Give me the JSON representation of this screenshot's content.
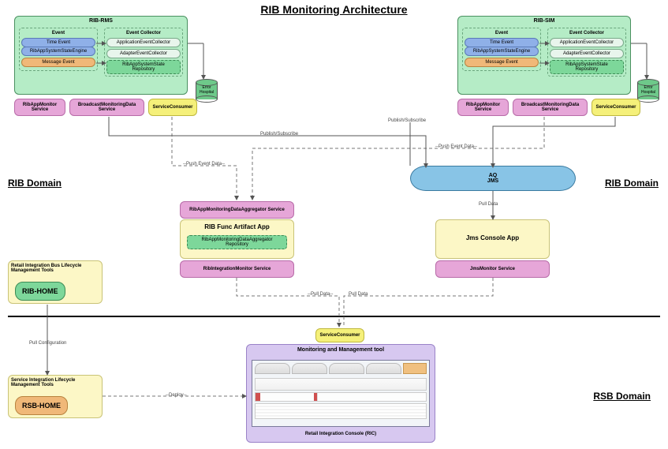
{
  "title": "RIB Monitoring Architecture",
  "domains": {
    "rib_left": "RIB Domain",
    "rib_right": "RIB Domain",
    "rsb": "RSB Domain"
  },
  "rib_rms": {
    "title": "RIB-RMS",
    "event_group": "Event",
    "time_event": "Time Event",
    "state_engine": "RibAppSystemStateEngine",
    "message_event": "Message Event",
    "collector_group": "Event Collector",
    "app_collector": "ApplicationEventCollector",
    "adapter_collector": "AdapterEventCollector",
    "repo": "RibAppSystemState Repository"
  },
  "rib_sim": {
    "title": "RIB-SIM",
    "event_group": "Event",
    "time_event": "Time Event",
    "state_engine": "RibAppSystemStateEngine",
    "message_event": "Message Event",
    "collector_group": "Event Collector",
    "app_collector": "ApplicationEventCollector",
    "adapter_collector": "AdapterEventCollector",
    "repo": "RibAppSystemState Repository"
  },
  "services": {
    "rib_app_monitor": "RibAppMonitor Service",
    "broadcast": "BroadcastMonitoringData Service",
    "service_consumer": "ServiceConsumer",
    "aggregator": "RibAppMonitoringDataAggregator Service",
    "integration_monitor": "RibIntegrationMonitor Service",
    "jms_monitor": "JmsMonitor Service"
  },
  "error_hospital": "Error Hospital",
  "func_artifact": {
    "title": "RIB Func Artifact App",
    "repo": "RibAppMonitoringDataAggregator Repository"
  },
  "jms_app": "Jms Console App",
  "aq_jms": {
    "line1": "AQ",
    "line2": "JMS"
  },
  "edges": {
    "pub_sub": "Publish/Subscribe",
    "push_event": "--Push Event Data--",
    "pull_data": "Pull Data",
    "pull_data_d": "--Pull Data--",
    "pull_config": "Pull Configuration",
    "deploy": "--Deploy--"
  },
  "tools": {
    "rib_tools": "Retail Integration Bus Lifecycle Management Tools",
    "rib_home": "RIB-HOME",
    "sib_tools": "Service Integration Lifecycle Management Tools",
    "rsb_home": "RSB-HOME"
  },
  "mgmt": {
    "title": "Monitoring and Management tool",
    "ric": "Retail Integration Console (RIC)"
  }
}
